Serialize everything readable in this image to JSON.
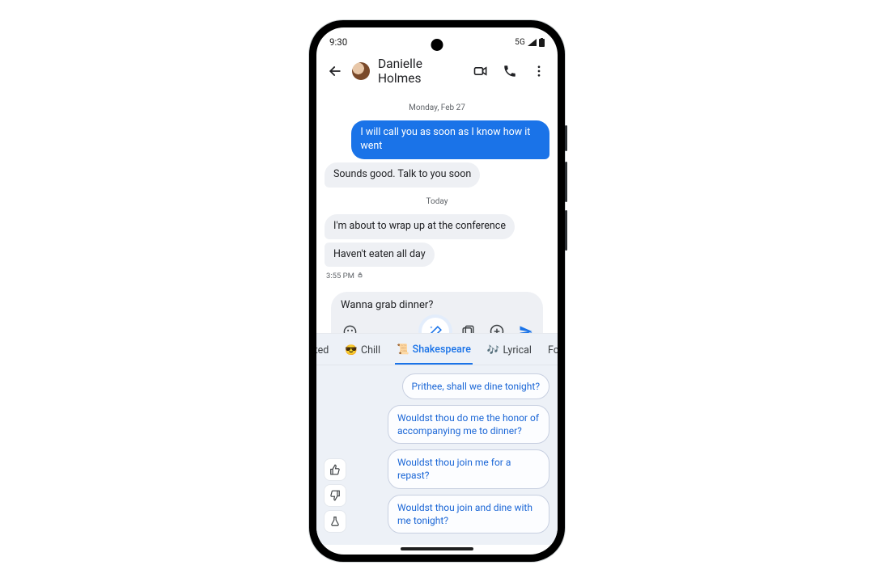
{
  "status": {
    "time": "9:30",
    "network": "5G"
  },
  "header": {
    "contact_name": "Danielle Holmes"
  },
  "dates": {
    "d1": "Monday, Feb 27",
    "d2": "Today"
  },
  "messages": {
    "m1": "I will call you as soon as I know how it went",
    "m2": "Sounds good. Talk to you soon",
    "m3": "I'm about to wrap up at the conference",
    "m4": "Haven't eaten all day",
    "ts": "3:55 PM"
  },
  "composer": {
    "draft": "Wanna grab dinner?"
  },
  "tabs": {
    "excited_partial": "cited",
    "chill": "Chill",
    "shakespeare": "Shakespeare",
    "lyrical": "Lyrical",
    "formal_partial": "For"
  },
  "tab_emoji": {
    "chill": "😎",
    "shakespeare": "📜",
    "lyrical": "🎶"
  },
  "suggestions": {
    "s1": "Prithee, shall we dine tonight?",
    "s2": "Wouldst thou do me the honor of accompanying me to dinner?",
    "s3": "Wouldst thou join me for a repast?",
    "s4": "Wouldst thou join and dine with me tonight?"
  }
}
